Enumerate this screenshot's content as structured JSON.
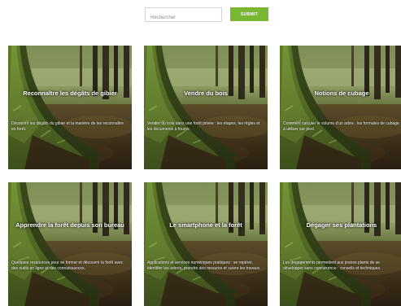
{
  "search": {
    "placeholder": "Rechercher",
    "submit_label": "SUBMIT"
  },
  "cards": [
    {
      "title": "Reconnaître les dégâts de gibier",
      "description": "Découvrir les dégâts du gibier et la manière de les reconnaître en forêt."
    },
    {
      "title": "Vendre du bois",
      "description": "Vendre du bois dans une forêt privée : les étapes, les règles et les documents à fournir."
    },
    {
      "title": "Notions de cubage",
      "description": "Comment calculer le volume d'un arbre : les formules de cubage à utiliser sur pied."
    },
    {
      "title": "Apprendre la forêt depuis son bureau",
      "description": "Quelques ressources pour se former et découvrir la forêt avec des outils en ligne et des connaissances."
    },
    {
      "title": "Le smartphone et la forêt",
      "description": "Applications et services numériques pratiques : se repérer, identifier les arbres, prendre des mesures et suivre les travaux."
    },
    {
      "title": "Dégager ses plantations",
      "description": "Les dégagements permettent aux jeunes plants de se développer sans concurrence : conseils et techniques."
    }
  ]
}
